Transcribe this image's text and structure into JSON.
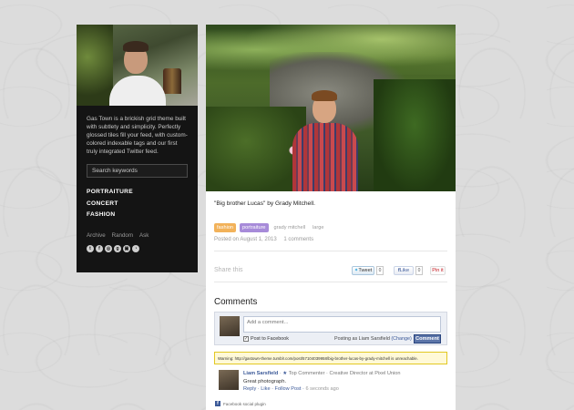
{
  "sidebar": {
    "description": "Gas Town is a brickish grid theme built with subtlety and simplicity. Perfectly glossed tiles fill your feed, with custom-colored indexable tags and our first truly integrated Twitter feed.",
    "search_placeholder": "Search keywords",
    "nav_main": [
      "PORTRAITURE",
      "CONCERT",
      "FASHION"
    ],
    "nav_sub": [
      "Archive",
      "Random",
      "Ask"
    ],
    "social_icons": [
      "tumblr-icon",
      "facebook-icon",
      "dribbble-icon",
      "google-icon",
      "instagram-icon",
      "rss-icon"
    ]
  },
  "post": {
    "caption": "\"Big brother Lucas\" by Grady Mitchell.",
    "tags": [
      "fashion",
      "portraiture",
      "grady mitchell",
      "large"
    ],
    "tag_colors": {
      "fashion": "#f2b25a",
      "portraiture": "#a78bd9"
    },
    "posted_on": "Posted on August 1, 2013",
    "comments_count": "1 comments",
    "share_label": "Share this",
    "tweet_label": "Tweet",
    "tweet_count": "0",
    "like_label": "Like",
    "like_count": "0",
    "pin_label": "Pin it"
  },
  "comments": {
    "title": "Comments",
    "input_placeholder": "Add a comment...",
    "post_to_facebook": "Post to Facebook",
    "posting_as": "Posting as Liam Sarsfield",
    "change_link": "(Change)",
    "submit_label": "Comment",
    "warning": "Warning: http://gastown-theme.tumblr.com/post/57104039958/big-brother-lucas-by-grady-mitchell is unreachable.",
    "items": [
      {
        "author": "Liam Sarsfield",
        "badge": "Top Commenter · Creative Director at Pixel Union",
        "text": "Great photograph.",
        "reply": "Reply",
        "like": "Like",
        "follow": "Follow Post",
        "time": "6 seconds ago"
      }
    ],
    "plugin_label": "Facebook social plugin"
  }
}
